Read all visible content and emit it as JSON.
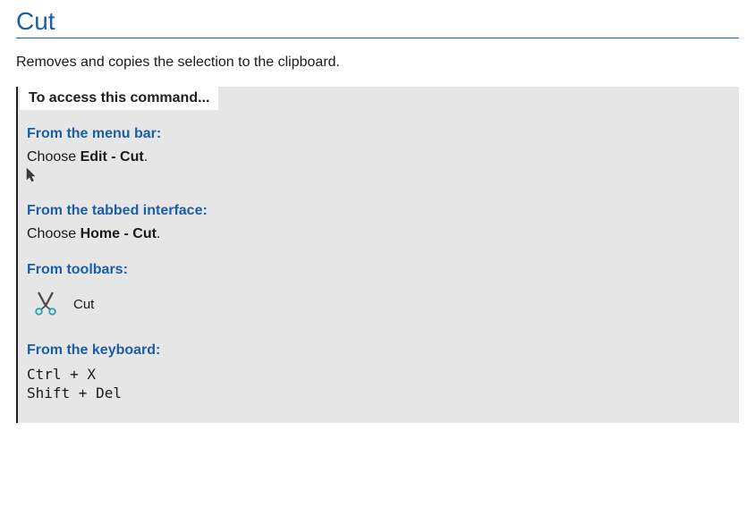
{
  "title": "Cut",
  "description": "Removes and copies the selection to the clipboard.",
  "access": {
    "header": "To access this command...",
    "menu_bar": {
      "title": "From the menu bar:",
      "prefix": "Choose ",
      "path": "Edit - Cut",
      "suffix": "."
    },
    "tabbed": {
      "title": "From the tabbed interface:",
      "prefix": "Choose ",
      "path": "Home - Cut",
      "suffix": "."
    },
    "toolbars": {
      "title": "From toolbars:",
      "label": "Cut"
    },
    "keyboard": {
      "title": "From the keyboard:",
      "shortcuts": [
        "Ctrl + X",
        "Shift + Del"
      ]
    }
  }
}
